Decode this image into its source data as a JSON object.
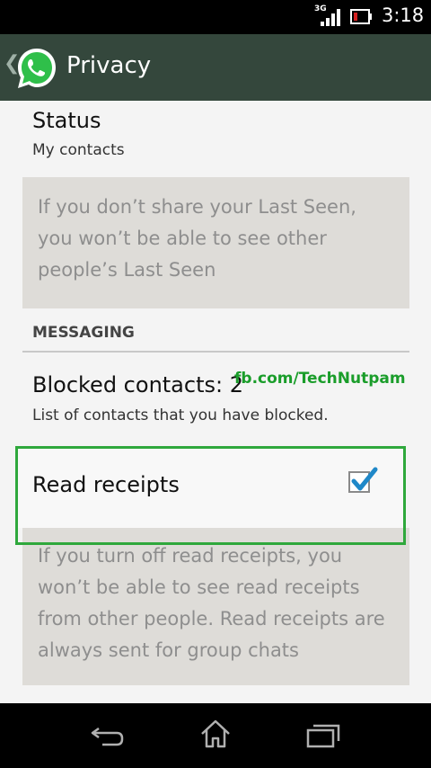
{
  "status_bar": {
    "network": "3G",
    "time": "3:18"
  },
  "action_bar": {
    "title": "Privacy"
  },
  "status_pref": {
    "title": "Status",
    "summary": "My contacts"
  },
  "last_seen_note": {
    "lines": [
      "If you don’t share your Last Seen,",
      "you won’t be able to see other",
      "people’s Last Seen"
    ]
  },
  "messaging_section": {
    "header": "MESSAGING"
  },
  "blocked_pref": {
    "title": "Blocked contacts: 2",
    "summary": "List of contacts that you have blocked."
  },
  "watermark": "fb.com/TechNutpam",
  "read_receipts": {
    "title": "Read receipts",
    "checked": true
  },
  "read_receipts_note": {
    "lines": [
      "If you turn off read receipts, you",
      "won’t be able to see read receipts",
      "from other people. Read receipts are",
      "always sent for group chats"
    ]
  },
  "colors": {
    "action_bar": "#34473c",
    "accent": "#2fa83c",
    "checkmark": "#1f88c8"
  },
  "nav_icons": [
    "back-icon",
    "home-icon",
    "recents-icon"
  ]
}
